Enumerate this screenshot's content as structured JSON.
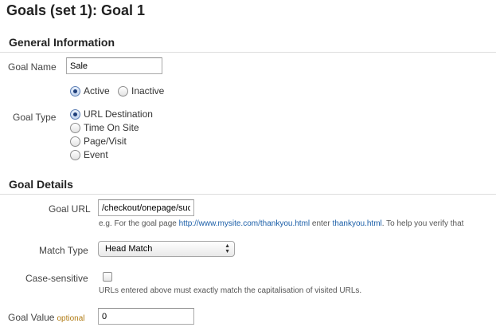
{
  "page": {
    "title": "Goals (set 1): Goal 1"
  },
  "general_information": {
    "header": "General Information",
    "goal_name": {
      "label": "Goal Name",
      "value": "Sale"
    },
    "status": {
      "options": [
        {
          "label": "Active",
          "selected": true
        },
        {
          "label": "Inactive",
          "selected": false
        }
      ]
    },
    "goal_type": {
      "label": "Goal Type",
      "options": [
        {
          "label": "URL Destination",
          "selected": true
        },
        {
          "label": "Time On Site",
          "selected": false
        },
        {
          "label": "Page/Visit",
          "selected": false
        },
        {
          "label": "Event",
          "selected": false
        }
      ]
    }
  },
  "goal_details": {
    "header": "Goal Details",
    "goal_url": {
      "label": "Goal URL",
      "value": "/checkout/onepage/success/",
      "hint": {
        "prefix": "e.g. For the goal page ",
        "example_url": "http://www.mysite.com/thankyou.html",
        "middle": " enter ",
        "example_path": "thankyou.html",
        "suffix": ". To help you verify that"
      }
    },
    "match_type": {
      "label": "Match Type",
      "selected": "Head Match"
    },
    "case_sensitive": {
      "label": "Case-sensitive",
      "checked": false,
      "hint": "URLs entered above must exactly match the capitalisation of visited URLs."
    },
    "goal_value": {
      "label": "Goal Value",
      "optional_label": "optional",
      "value": "0"
    }
  },
  "colors": {
    "link": "#1a5ea8",
    "optional": "#b07a12",
    "section_rule": "#dddddd"
  }
}
